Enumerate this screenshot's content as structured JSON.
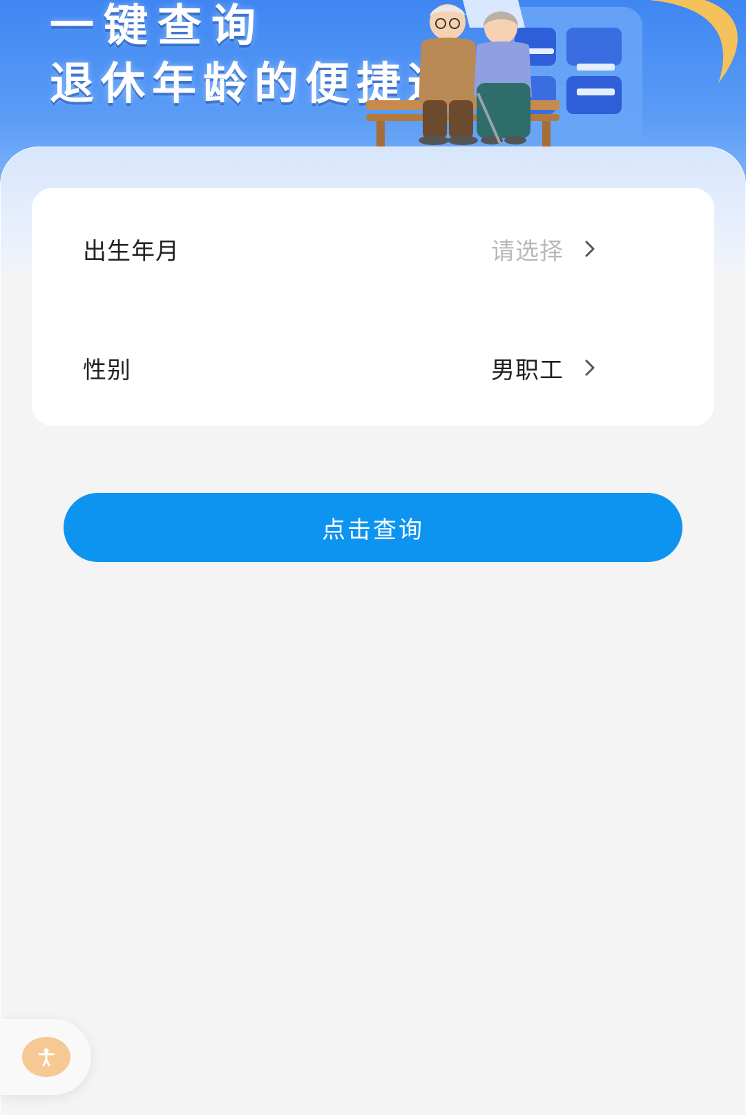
{
  "banner": {
    "title_line1": "一键查询",
    "title_line2": "退休年龄的便捷通道",
    "illustration_icon": "elderly-couple-on-bench-illustration"
  },
  "form": {
    "birth": {
      "label": "出生年月",
      "value": "请选择",
      "value_is_placeholder": true
    },
    "gender": {
      "label": "性别",
      "value": "男职工"
    }
  },
  "actions": {
    "query_label": "点击查询"
  },
  "accessibility": {
    "icon": "accessibility-person-icon"
  },
  "colors": {
    "primary": "#0d93f0",
    "banner_top": "#3f86f2",
    "page_bg": "#f4f4f5",
    "placeholder": "#b8b8b8",
    "a11y": "#f6c894"
  }
}
